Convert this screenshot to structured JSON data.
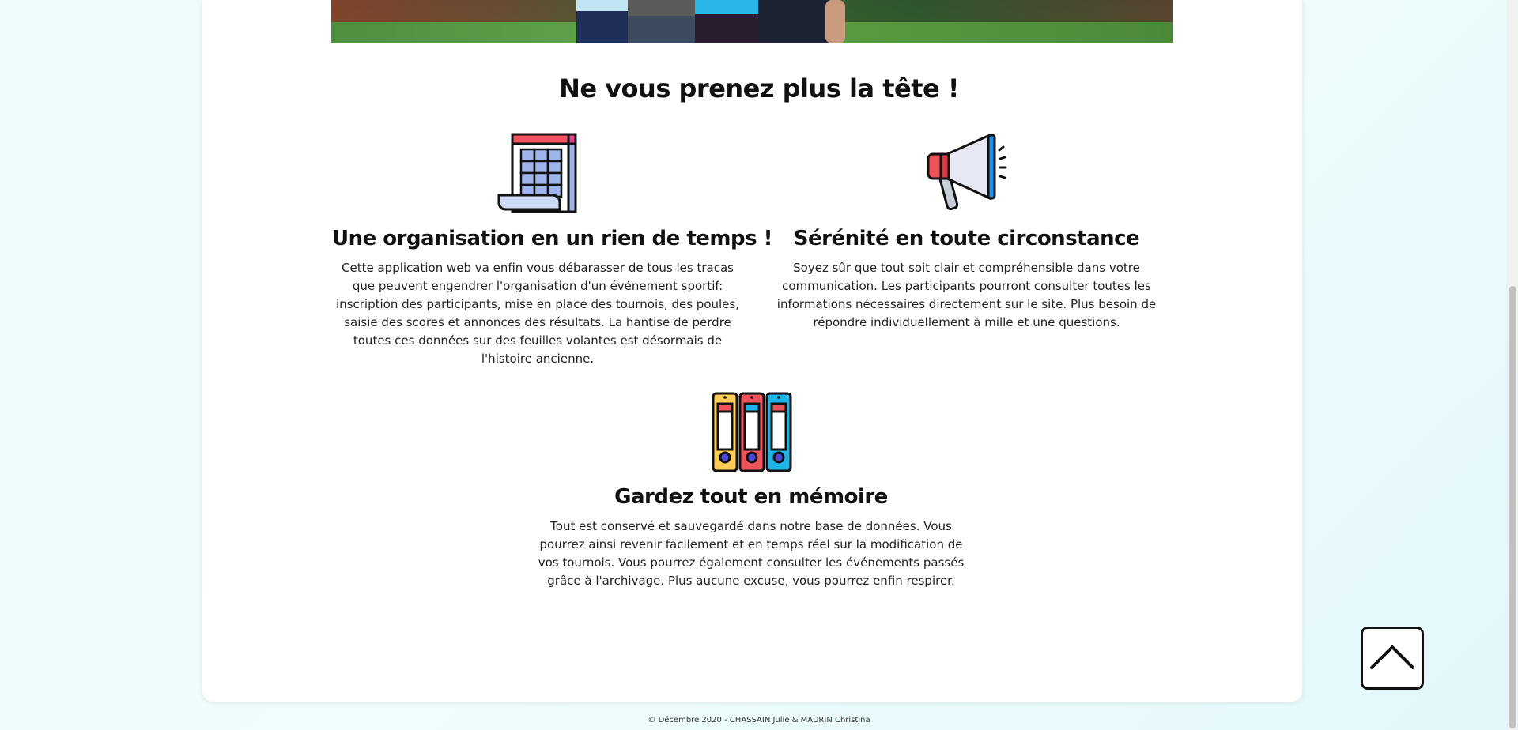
{
  "main": {
    "title": "Ne vous prenez plus la tête !"
  },
  "features": [
    {
      "icon": "calendar-icon",
      "title": "Une organisation en un rien de temps !",
      "text": "Cette application web va enfin vous débarasser de tous les tracas que peuvent engendrer l'organisation d'un événement sportif: inscription des participants, mise en place des tournois, des poules, saisie des scores et annonces des résultats. La hantise de perdre toutes ces données sur des feuilles volantes est désormais de l'histoire ancienne."
    },
    {
      "icon": "megaphone-icon",
      "title": "Sérénité en toute circonstance",
      "text": "Soyez sûr que tout soit clair et compréhensible dans votre communication. Les participants pourront consulter toutes les informations nécessaires directement sur le site. Plus besoin de répondre individuellement à mille et une questions."
    },
    {
      "icon": "binders-icon",
      "title": "Gardez tout en mémoire",
      "text": "Tout est conservé et sauvegardé dans notre base de données. Vous pourrez ainsi revenir facilement et en temps réel sur la modification de vos tournois. Vous pourrez également consulter les événements passés grâce à l'archivage. Plus aucune excuse, vous pourrez enfin respirer."
    }
  ],
  "back_to_top": {
    "icon": "chevron-up-icon"
  },
  "footer": {
    "text": "© Décembre 2020 - CHASSAIN Julie & MAURIN Christina"
  },
  "colors": {
    "icon_red": "#f0525a",
    "icon_blue": "#1fb4e8",
    "icon_yellow": "#ffcc55",
    "icon_lavender": "#9fb4ea",
    "outline": "#111111"
  }
}
